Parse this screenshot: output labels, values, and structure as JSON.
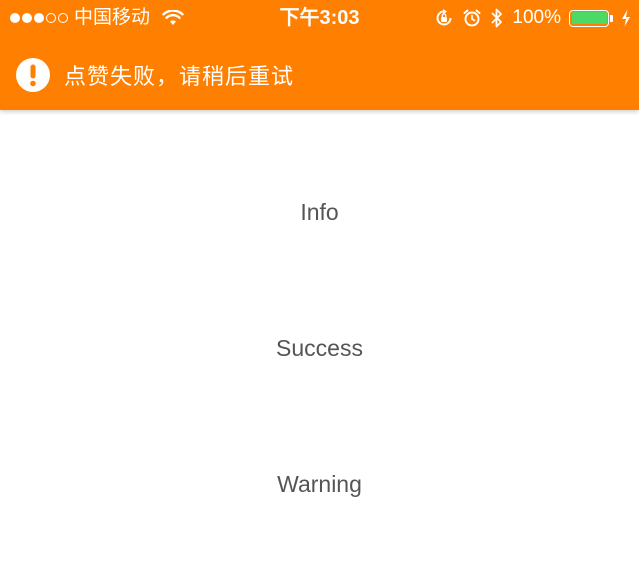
{
  "status_bar": {
    "carrier": "中国移动",
    "time": "下午3:03",
    "battery_percent": "100%",
    "signal_bars_filled": 3,
    "signal_bars_total": 5,
    "icons": [
      "wifi-icon",
      "orientation-lock-icon",
      "alarm-icon",
      "bluetooth-icon",
      "battery-icon",
      "charging-icon"
    ],
    "battery_level": 1.0,
    "battery_color": "#4CD964"
  },
  "notice": {
    "icon": "exclamation-icon",
    "message": "点赞失败，请稍后重试",
    "background_color": "#FF7F00"
  },
  "buttons": {
    "info": "Info",
    "success": "Success",
    "warning": "Warning"
  }
}
